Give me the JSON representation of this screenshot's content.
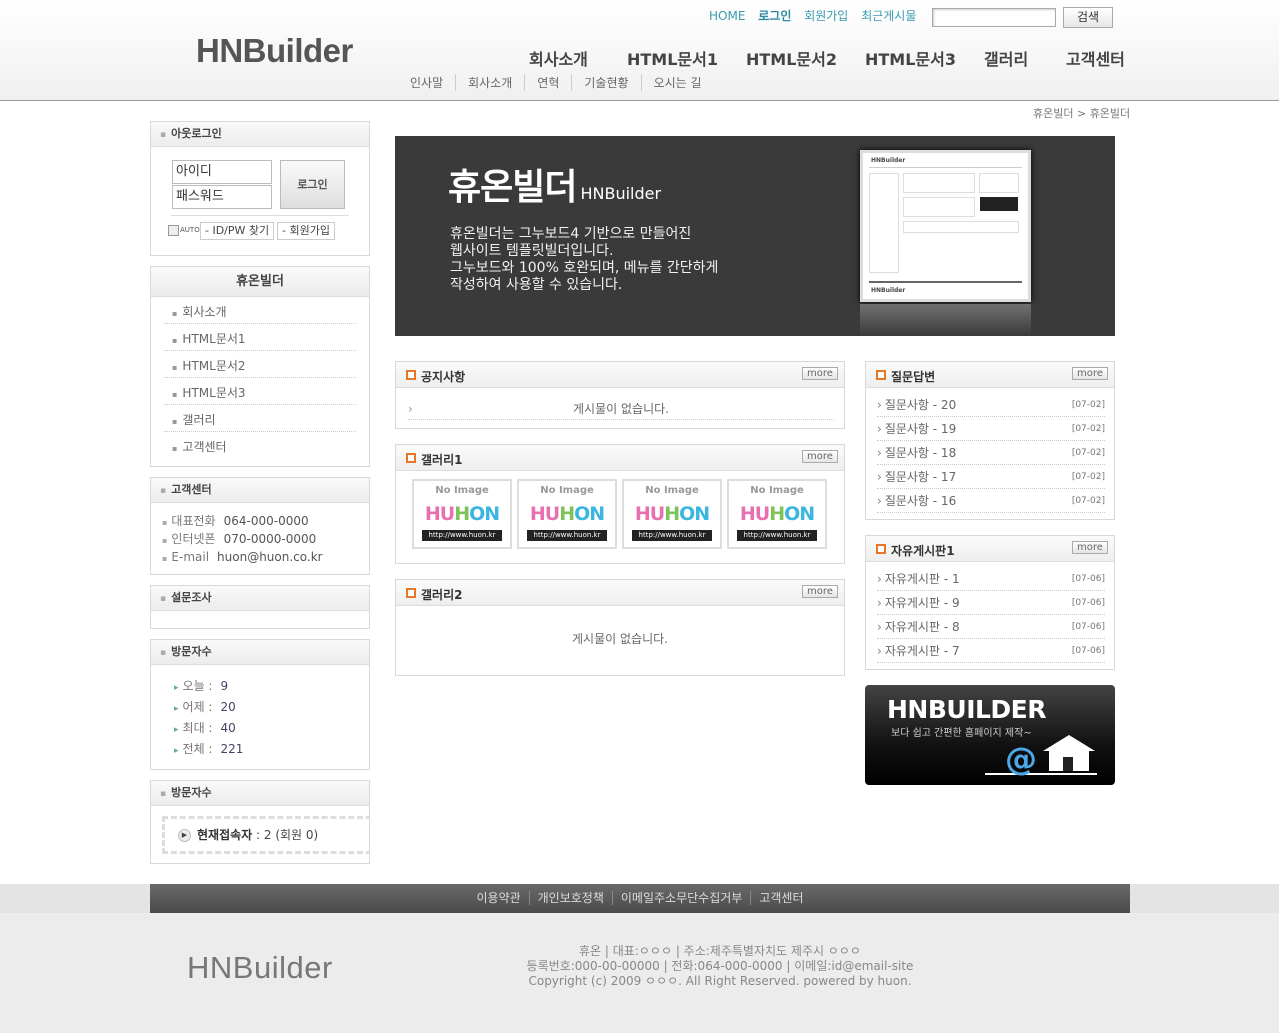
{
  "header": {
    "logo": "HNBuilder",
    "toplinks": [
      "HOME",
      "로그인",
      "회원가입",
      "최근게시물"
    ],
    "search_button": "검색",
    "gnb": [
      "회사소개",
      "HTML문서1",
      "HTML문서2",
      "HTML문서3",
      "갤러리",
      "고객센터"
    ],
    "subnav": [
      "인사말",
      "회사소개",
      "연혁",
      "기술현황",
      "오시는 길"
    ]
  },
  "breadcrumb": "휴온빌더 > 휴온빌더",
  "login": {
    "title": "아웃로그인",
    "id_placeholder": "아이디",
    "pw_placeholder": "패스워드",
    "login_button": "로그인",
    "auto_label": "AUTO",
    "find_button": "ID/PW 찾기",
    "join_button": "회원가입"
  },
  "side_menu": {
    "title": "휴온빌더",
    "items": [
      "회사소개",
      "HTML문서1",
      "HTML문서2",
      "HTML문서3",
      "갤러리",
      "고객센터"
    ]
  },
  "customer_center": {
    "title": "고객센터",
    "rows": [
      {
        "label": "대표전화",
        "value": "064-000-0000"
      },
      {
        "label": "인터넷폰",
        "value": "070-0000-0000"
      },
      {
        "label": "E-mail",
        "value": "huon@huon.co.kr"
      }
    ]
  },
  "survey": {
    "title": "설문조사"
  },
  "visitors": {
    "title": "방문자수",
    "rows": [
      {
        "label": "오늘 :",
        "value": "9"
      },
      {
        "label": "어제 :",
        "value": "20"
      },
      {
        "label": "최대 :",
        "value": "40"
      },
      {
        "label": "전체 :",
        "value": "221"
      }
    ]
  },
  "connect": {
    "title": "방문자수",
    "label": "현재접속자",
    "value": " : 2 (회원 0)"
  },
  "banner": {
    "title": "휴온빌더",
    "title_small": "HNBuilder",
    "desc_lines": [
      "휴온빌더는 그누보드4 기반으로 만들어진",
      "웹사이트 템플릿빌더입니다.",
      "그누보드와 100% 호완되며, 메뉴를 간단하게",
      "작성하여 사용할 수 있습니다."
    ],
    "shot_logo": "HNBuilder",
    "shot_footer_logo": "HNBuilder"
  },
  "notice": {
    "title": "공지사항",
    "more": "more",
    "empty": "게시물이 없습니다."
  },
  "gallery1": {
    "title": "갤러리1",
    "more": "more",
    "thumbs": [
      {
        "noimg": "No Image",
        "logo": "HUHON",
        "url": "http://www.huon.kr"
      },
      {
        "noimg": "No Image",
        "logo": "HUHON",
        "url": "http://www.huon.kr"
      },
      {
        "noimg": "No Image",
        "logo": "HUHON",
        "url": "http://www.huon.kr"
      },
      {
        "noimg": "No Image",
        "logo": "HUHON",
        "url": "http://www.huon.kr"
      }
    ]
  },
  "gallery2": {
    "title": "갤러리2",
    "more": "more",
    "empty": "게시물이 없습니다."
  },
  "qna": {
    "title": "질문답변",
    "more": "more",
    "items": [
      {
        "title": "질문사항 - 20",
        "date": "[07-02]"
      },
      {
        "title": "질문사항 - 19",
        "date": "[07-02]"
      },
      {
        "title": "질문사항 - 18",
        "date": "[07-02]"
      },
      {
        "title": "질문사항 - 17",
        "date": "[07-02]"
      },
      {
        "title": "질문사항 - 16",
        "date": "[07-02]"
      }
    ]
  },
  "free_board": {
    "title": "자유게시판1",
    "more": "more",
    "items": [
      {
        "title": "자유게시판 - 1",
        "date": "[07-06]"
      },
      {
        "title": "자유게시판 - 9",
        "date": "[07-06]"
      },
      {
        "title": "자유게시판 - 8",
        "date": "[07-06]"
      },
      {
        "title": "자유게시판 - 7",
        "date": "[07-06]"
      }
    ]
  },
  "hn_banner": {
    "title": "HNBUILDER",
    "sub": "보다 쉽고 간편한 홈페이지 제작~"
  },
  "footer": {
    "links": [
      "이용약관",
      "개인보호정책",
      "이메일주소무단수집거부",
      "고객센터"
    ],
    "logo": "HNBuilder",
    "info_lines": [
      "휴온 | 대표:ㅇㅇㅇ | 주소:제주특별자치도 제주시 ㅇㅇㅇ",
      "등록번호:000-00-00000 | 전화:064-000-0000 | 이메일:id@email-site",
      "Copyright (c) 2009 ㅇㅇㅇ. All Right Reserved. powered by huon."
    ]
  },
  "colors": {
    "link_teal": "#3a9bb0",
    "panel_bullet": "#e8762a",
    "banner_bg": "#3a3a3a",
    "footer_bar": "#5a5a5a"
  }
}
